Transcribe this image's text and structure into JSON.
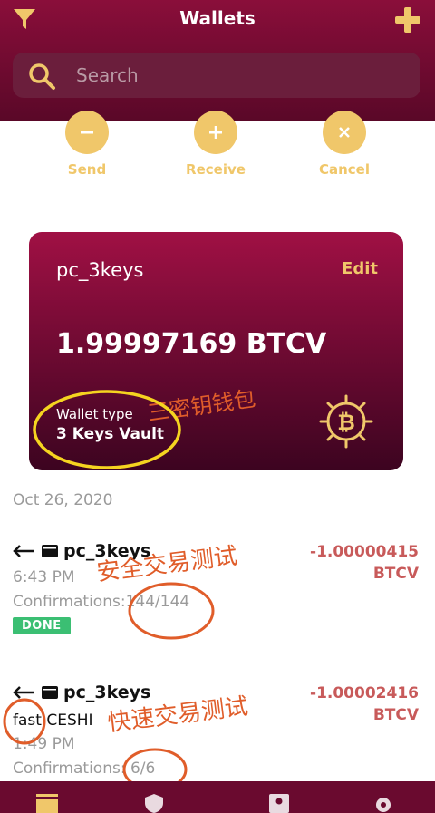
{
  "header": {
    "title": "Wallets",
    "search_placeholder": "Search"
  },
  "actions": [
    {
      "label": "Send"
    },
    {
      "label": "Receive"
    },
    {
      "label": "Cancel"
    }
  ],
  "wallet_card": {
    "name": "pc_3keys",
    "edit_label": "Edit",
    "balance": "1.99997169 BTCV",
    "type_label": "Wallet type",
    "type_value": "3 Keys Vault"
  },
  "date_header": "Oct 26, 2020",
  "transactions": [
    {
      "wallet": "pc_3keys",
      "time": "6:43 PM",
      "confirmations_label": "Confirmations:",
      "confirmations": "144/144",
      "status": "DONE",
      "amount": "-1.00000415",
      "unit": "BTCV"
    },
    {
      "wallet": "pc_3keys",
      "description": "fast CESHI",
      "time": "1:49 PM",
      "confirmations_label": "Confirmations:",
      "confirmations": "6/6",
      "amount": "-1.00002416",
      "unit": "BTCV"
    }
  ],
  "annotations": {
    "wallet_type_note": "三密钥钱包",
    "tx1_note": "安全交易测试",
    "tx2_note": "快速交易测试"
  },
  "colors": {
    "header": "#8a0e3a",
    "accent": "#f0c76a",
    "debit": "#c85a5a",
    "done": "#3bbf73",
    "annotation": "#e05d2a",
    "highlight_circle": "#f5d420"
  }
}
